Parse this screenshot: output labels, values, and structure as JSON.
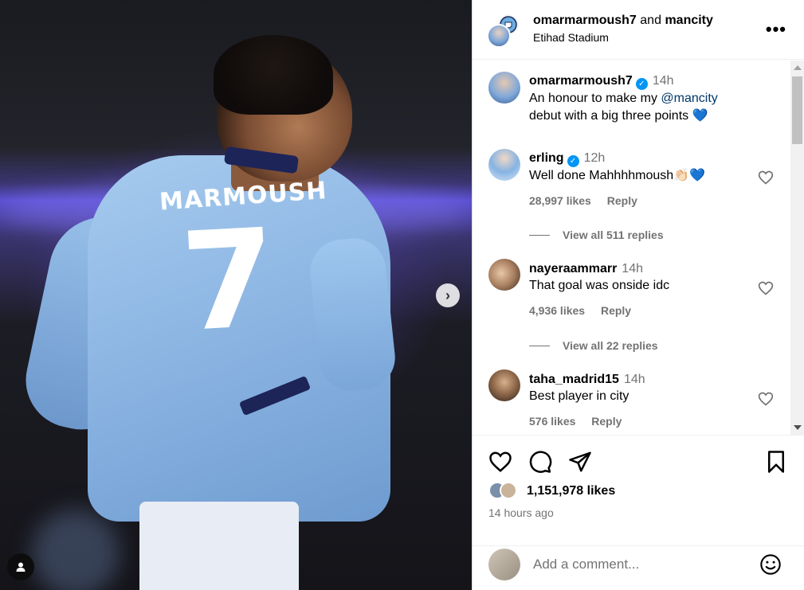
{
  "post": {
    "image_alt": "Player wearing number 7 Marmoush shirt",
    "jersey_name": "MARMOUSH",
    "jersey_number": "7",
    "next_glyph": "›"
  },
  "header": {
    "user1": "omarmarmoush7",
    "conjunction": "and",
    "user2": "mancity",
    "location": "Etihad Stadium",
    "more_glyph": "•••"
  },
  "caption": {
    "user": "omarmarmoush7",
    "time": "14h",
    "text_before": "An honour to make my ",
    "mention": "@mancity",
    "text_after": "debut with a big three points 💙"
  },
  "comments": [
    {
      "user": "erling",
      "verified": true,
      "time": "12h",
      "text": "Well done Mahhhhmoush👏🏻💙",
      "likes": "28,997 likes",
      "reply": "Reply",
      "view_replies": "View all 511 replies"
    },
    {
      "user": "nayeraammarr",
      "verified": false,
      "time": "14h",
      "text": "That goal was onside idc",
      "likes": "4,936 likes",
      "reply": "Reply",
      "view_replies": "View all 22 replies"
    },
    {
      "user": "taha_madrid15",
      "verified": false,
      "time": "14h",
      "text": "Best player in city",
      "likes": "576 likes",
      "reply": "Reply"
    }
  ],
  "actions": {
    "likes": "1,151,978 likes",
    "posted": "14 hours ago"
  },
  "comment_box": {
    "placeholder": "Add a comment..."
  },
  "colors": {
    "verified": "#0095f6",
    "mention": "#00376b",
    "secondary_text": "#737373"
  }
}
